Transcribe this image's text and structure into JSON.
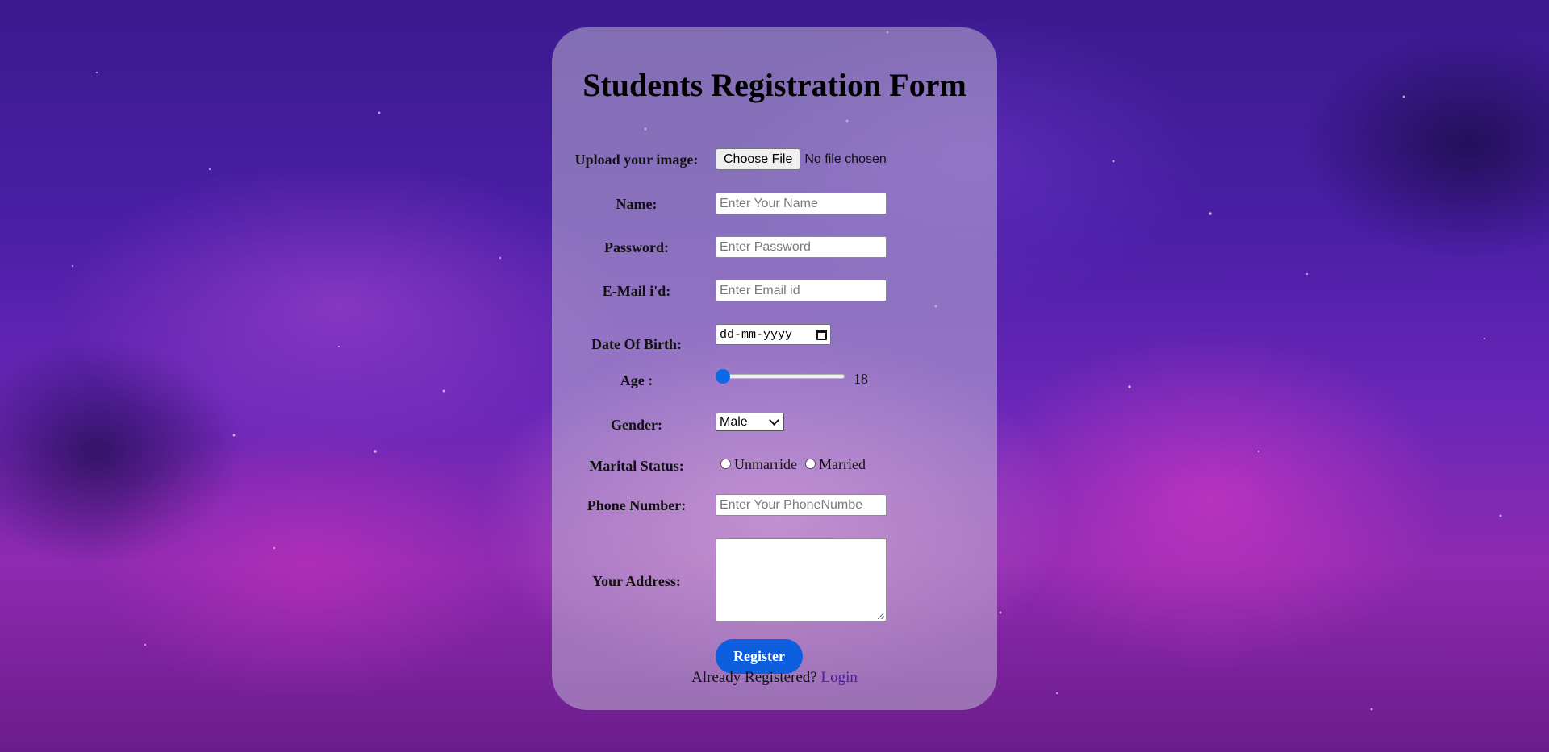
{
  "form": {
    "title": "Students Registration Form",
    "upload": {
      "label": "Upload your image:",
      "button": "Choose File",
      "status": "No file chosen"
    },
    "name": {
      "label": "Name:",
      "placeholder": "Enter Your Name"
    },
    "password": {
      "label": "Password:",
      "placeholder": "Enter Password"
    },
    "email": {
      "label": "E-Mail i'd:",
      "placeholder": "Enter Email id"
    },
    "dob": {
      "label": "Date Of Birth:",
      "value": "dd-mm-yyyy"
    },
    "age": {
      "label": "Age :",
      "value": "18",
      "level": 0
    },
    "gender": {
      "label": "Gender:",
      "selected": "Male"
    },
    "marital": {
      "label": "Marital Status:",
      "options": [
        "Unmarride",
        "Married"
      ]
    },
    "phone": {
      "label": "Phone Number:",
      "placeholder": "Enter Your PhoneNumbe"
    },
    "address": {
      "label": "Your Address:"
    },
    "register_button": "Register",
    "footer": {
      "text": "Already Registered?",
      "link": "Login"
    }
  },
  "colors": {
    "accent": "#0d5fe0",
    "link": "#4b1e99",
    "card": "rgba(190,180,210,0.55)"
  }
}
